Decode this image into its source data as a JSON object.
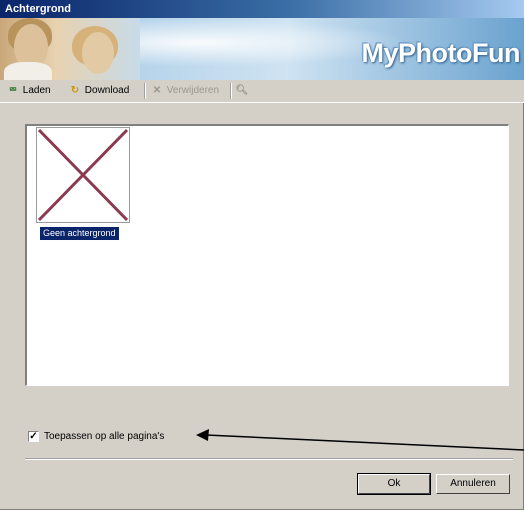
{
  "window": {
    "title": "Achtergrond"
  },
  "banner": {
    "logo_text": "MyPhotoFun"
  },
  "toolbar": {
    "items": [
      {
        "label": "Laden",
        "icon": "load-icon",
        "enabled": true
      },
      {
        "label": "Download",
        "icon": "download-icon",
        "enabled": true
      },
      {
        "label": "Verwijderen",
        "icon": "delete-icon",
        "enabled": false
      },
      {
        "label": "",
        "icon": "search-icon",
        "enabled": false
      }
    ]
  },
  "gallery": {
    "items": [
      {
        "label": "Geen achtergrond",
        "selected": true,
        "icon": "no-background-cross-icon"
      }
    ]
  },
  "options": {
    "apply_all_label": "Toepassen op alle pagina's",
    "apply_all_checked": true
  },
  "buttons": {
    "ok": "Ok",
    "cancel": "Annuleren"
  },
  "colors": {
    "title_bar": "#0a246a",
    "selection": "#0a246a",
    "cross": "#8b3a50",
    "dialog_bg": "#d4d0c8"
  }
}
